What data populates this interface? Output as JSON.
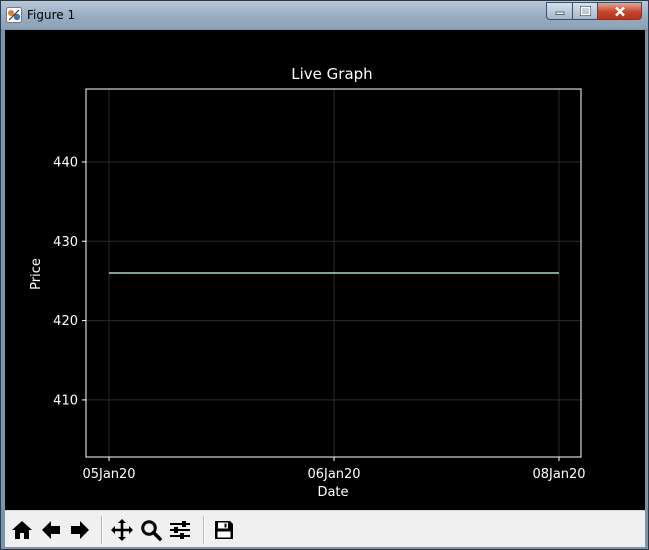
{
  "window": {
    "title": "Figure 1",
    "controls": [
      "minimize-icon",
      "maximize-icon",
      "close-icon"
    ]
  },
  "colors": {
    "background": "#000000",
    "axes_edge": "#ffffff",
    "grid": "#2a2a2a",
    "line": "#a3d9d6",
    "text": "#ffffff"
  },
  "toolbar": {
    "buttons": [
      "home-icon",
      "back-icon",
      "forward-icon",
      "pan-icon",
      "zoom-icon",
      "configure-subplots-icon",
      "save-icon"
    ]
  },
  "chart_data": {
    "type": "line",
    "title": "Live Graph",
    "xlabel": "Date",
    "ylabel": "Price",
    "x_ticks": [
      "05Jan20",
      "06Jan20",
      "08Jan20"
    ],
    "y_ticks": [
      410,
      420,
      430,
      440
    ],
    "ylim": [
      402.8,
      449.2
    ],
    "grid": true,
    "series": [
      {
        "x": [
          "05Jan20",
          "06Jan20",
          "08Jan20"
        ],
        "values": [
          426,
          426,
          426
        ]
      }
    ]
  }
}
